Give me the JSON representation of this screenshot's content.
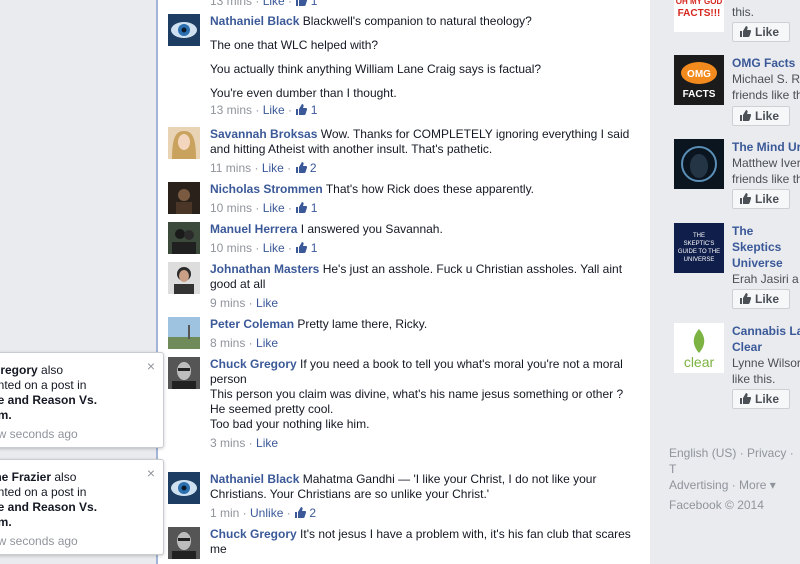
{
  "comments": [
    {
      "author": "",
      "lines": [],
      "time": "13 mins",
      "like": "Like",
      "likes": "1"
    },
    {
      "author": "Nathaniel Black",
      "lines": [
        "Blackwell's companion to natural theology?",
        "The one that WLC helped with?",
        "You actually think anything William Lane Craig says is factual?",
        "You're even dumber than I thought."
      ],
      "time": "13 mins",
      "like": "Like",
      "likes": "1"
    },
    {
      "author": "Savannah Broksas",
      "lines": [
        "Wow. Thanks for COMPLETELY ignoring everything I said and hitting Atheist with another insult. That's pathetic."
      ],
      "time": "11 mins",
      "like": "Like",
      "likes": "2"
    },
    {
      "author": "Nicholas Strommen",
      "lines": [
        "That's how Rick does these apparently."
      ],
      "time": "10 mins",
      "like": "Like",
      "likes": "1"
    },
    {
      "author": "Manuel Herrera",
      "lines": [
        "I answered you Savannah."
      ],
      "time": "10 mins",
      "like": "Like",
      "likes": "1"
    },
    {
      "author": "Johnathan Masters",
      "lines": [
        "He's just an asshole. Fuck u Christian assholes. Yall aint good at all"
      ],
      "time": "9 mins",
      "like": "Like",
      "likes": ""
    },
    {
      "author": "Peter Coleman",
      "lines": [
        "Pretty lame there, Ricky."
      ],
      "time": "8 mins",
      "like": "Like",
      "likes": ""
    },
    {
      "author": "Chuck Gregory",
      "lines": [
        "If you need a book to tell you what's moral you're not a moral person",
        "This person you claim was divine, what's his name jesus something or other ?",
        "He seemed pretty cool.",
        "Too bad your nothing like him."
      ],
      "time": "3 mins",
      "like": "Like",
      "likes": ""
    },
    {
      "author": "Nathaniel Black",
      "lines": [
        "Mahatma Gandhi — 'I like your Christ, I do not like your Christians. Your Christians are so unlike your Christ.'"
      ],
      "time": "1 min",
      "like": "Unlike",
      "likes": "2"
    },
    {
      "author": "Chuck Gregory",
      "lines": [
        "It's not jesus I have a problem with, it's his fan club that scares me"
      ],
      "time": "",
      "like": "",
      "likes": ""
    }
  ],
  "pages": [
    {
      "name": "",
      "sub": "this.",
      "img_text": "OH MY GOD FACTS!!!",
      "like": "Like"
    },
    {
      "name": "OMG Facts",
      "sub": "Michael S. R",
      "sub2": "friends like th",
      "img_text": "OMG FACTS",
      "like": "Like"
    },
    {
      "name": "The Mind Ur",
      "sub": "Matthew Iver",
      "sub2": "friends like th",
      "img_text": "",
      "like": "Like"
    },
    {
      "name": "The Skeptics Universe",
      "sub": "Erah Jasiri a",
      "sub2": "",
      "img_text": "THE SKEPTIC'S GUIDE TO THE UNIVERSE",
      "like": "Like"
    },
    {
      "name": "Cannabis La Clear",
      "sub": "Lynne Wilsor",
      "sub2": "like this.",
      "img_text": "clear",
      "like": "Like"
    }
  ],
  "footer": {
    "line1": "English (US) · Privacy · T",
    "line2": "Advertising · More ▾",
    "line3": "Facebook © 2014"
  },
  "notifications": [
    {
      "name": "Gregory",
      "t1": "also",
      "t2": "ented on a post in",
      "post1": "ce and Reason Vs.",
      "post2": "sm.",
      "time": "ew seconds ago",
      "close": "×"
    },
    {
      "name": "ine Frazier",
      "t1": "also",
      "t2": "ented on a post in",
      "post1": "ce and Reason Vs.",
      "post2": "sm.",
      "time": "ew seconds ago",
      "close": "×"
    }
  ],
  "colors": {
    "link": "#3b5998",
    "muted": "#90949c",
    "background": "#e9ebee"
  }
}
